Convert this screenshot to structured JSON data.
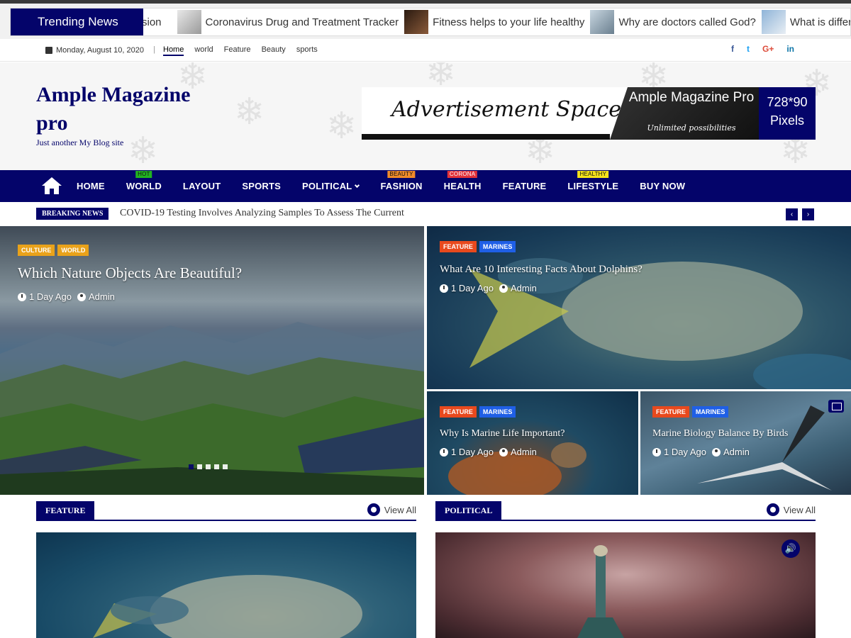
{
  "trending": {
    "label": "Trending News",
    "items": [
      {
        "text": "sion",
        "thumb": "none"
      },
      {
        "text": "Coronavirus Drug and Treatment Tracker",
        "thumb": "a"
      },
      {
        "text": "Fitness helps to your life healthy",
        "thumb": "b"
      },
      {
        "text": "Why are doctors called God?",
        "thumb": "c"
      },
      {
        "text": "What is differ",
        "thumb": "d"
      }
    ]
  },
  "topbar": {
    "date": "Monday, August 10, 2020",
    "links": [
      "Home",
      "world",
      "Feature",
      "Beauty",
      "sports"
    ],
    "social": [
      "f",
      "t",
      "G+",
      "in"
    ]
  },
  "header": {
    "site_title": "Ample Magazine pro",
    "tagline": "Just another My Blog site",
    "ad": {
      "text": "Advertisement Space",
      "brand": "Ample Magazine Pro",
      "sub": "Unlimited possibilities",
      "size": "728*90 Pixels"
    }
  },
  "nav": {
    "items": [
      {
        "label": "HOME",
        "tag": "",
        "tag_color": ""
      },
      {
        "label": "WORLD",
        "tag": "HOT",
        "tag_color": "#21b321"
      },
      {
        "label": "LAYOUT",
        "tag": "",
        "tag_color": ""
      },
      {
        "label": "SPORTS",
        "tag": "",
        "tag_color": ""
      },
      {
        "label": "POLITICAL",
        "tag": "",
        "tag_color": ""
      },
      {
        "label": "FASHION",
        "tag": "BEAUTY",
        "tag_color": "#f08a2a"
      },
      {
        "label": "HEALTH",
        "tag": "CORONA",
        "tag_color": "#e2323a"
      },
      {
        "label": "FEATURE",
        "tag": "",
        "tag_color": ""
      },
      {
        "label": "LIFESTYLE",
        "tag": "HEALTHY",
        "tag_color": "#f5e21a"
      },
      {
        "label": "BUY NOW",
        "tag": "",
        "tag_color": ""
      }
    ]
  },
  "breaking": {
    "label": "BREAKING NEWS",
    "text": "COVID-19 Testing Involves Analyzing Samples To Assess The Current",
    "prev": "‹",
    "next": "›"
  },
  "hero": {
    "main": {
      "cats": [
        "CULTURE",
        "WORLD"
      ],
      "title": "Which Nature Objects Are Beautiful?",
      "time": "1 Day Ago",
      "author": "Admin"
    },
    "top": {
      "cats": [
        "FEATURE",
        "MARINES"
      ],
      "title": "What Are 10 Interesting Facts About Dolphins?",
      "time": "1 Day Ago",
      "author": "Admin"
    },
    "b1": {
      "cats": [
        "FEATURE",
        "MARINES"
      ],
      "title": "Why Is Marine Life Important?",
      "time": "1 Day Ago",
      "author": "Admin"
    },
    "b2": {
      "cats": [
        "FEATURE",
        "MARINES"
      ],
      "title": "Marine Biology Balance By Birds",
      "time": "1 Day Ago",
      "author": "Admin"
    }
  },
  "sections": {
    "feature": {
      "label": "FEATURE",
      "view_all": "View All"
    },
    "political": {
      "label": "POLITICAL",
      "view_all": "View All"
    }
  },
  "colors": {
    "brand": "#04046a",
    "orange": "#e8491d",
    "blue": "#1f5fe6",
    "gold": "#e9a21a"
  }
}
